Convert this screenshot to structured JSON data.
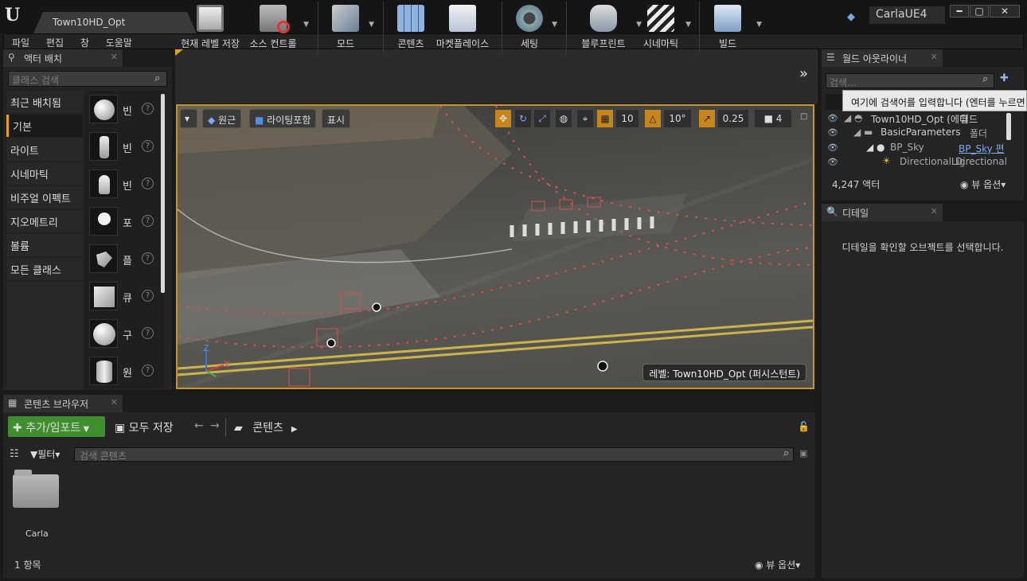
{
  "window": {
    "doc_tab": "Town10HD_Opt",
    "project": "CarlaUE4",
    "minimize": "━",
    "maximize": "▢",
    "close": "✕"
  },
  "menu": [
    "파일",
    "편집",
    "창",
    "도움말"
  ],
  "place_actors": {
    "tab_label": "액터 배치",
    "search_placeholder": "클래스 검색",
    "categories": [
      "최근 배치됨",
      "기본",
      "라이트",
      "시네마틱",
      "비주얼 이펙트",
      "지오메트리",
      "볼륨",
      "모든 클래스"
    ],
    "active_category": "기본",
    "items": [
      "빈 ",
      "빈 ",
      "빈 ",
      "포",
      "플",
      "큐",
      "구",
      "원"
    ]
  },
  "toolbar": {
    "buttons": [
      "현재 레벨 저장",
      "소스 컨트롤",
      "모드",
      "콘텐츠",
      "마켓플레이스",
      "세팅",
      "블루프린트",
      "시네마틱",
      "빌드"
    ]
  },
  "viewport": {
    "perspective": "원근",
    "lighting": "라이팅포함",
    "show": "표시",
    "grid_snap": "10",
    "rotate_snap": "10°",
    "scale_snap": "0.25",
    "camera_speed": "4",
    "level_label": "레벨:  Town10HD_Opt (퍼시스턴트)",
    "axis_z": "Z",
    "axis_x": "X"
  },
  "outliner": {
    "tab_label": "월드 아웃라이너",
    "search_placeholder": "검색...",
    "tooltip": "여기에 검색어를 입력합니다 (엔터를 누르면 결과",
    "rows": [
      {
        "name": "Town10HD_Opt (에디",
        "type": "월드"
      },
      {
        "name": "BasicParameters",
        "type": "폴더"
      },
      {
        "name": "BP_Sky",
        "type": "BP_Sky 편"
      },
      {
        "name": "DirectionalLig",
        "type": "Directional"
      }
    ],
    "actor_count": "4,247 액터",
    "view_options": "뷰 옵션"
  },
  "details": {
    "tab_label": "디테일",
    "empty_message": "디테일을 확인할 오브젝트를 선택합니다."
  },
  "content_browser": {
    "tab_label": "콘텐츠 브라우저",
    "add_import": "추가/임포트",
    "save_all": "모두 저장",
    "path": "콘텐츠",
    "filter": "필터",
    "search_placeholder": "검색 콘텐츠",
    "folder_name": "Carla",
    "item_count": "1 항목",
    "view_options": "뷰 옵션"
  },
  "colors": {
    "accent": "#e8a11a",
    "add_button": "#3f8f2e"
  }
}
